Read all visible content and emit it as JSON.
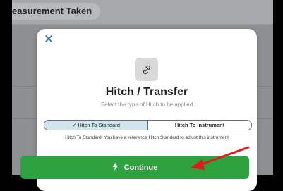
{
  "background": {
    "header_title": "easurement Taken"
  },
  "modal": {
    "close_icon": "close-icon",
    "feature_icon": "link-icon",
    "title": "Hitch / Transfer",
    "subtitle": "Select the type of Hitch to be applied",
    "segments": [
      {
        "label": "✓ Hitch To Standard",
        "selected": true
      },
      {
        "label": "Hitch To Instrument",
        "selected": false
      }
    ],
    "hint": "Hitch To Standard: You have a reference Hitch Standard to adjust this instrument",
    "continue_label": "Continue",
    "continue_icon": "bolt-icon"
  },
  "colors": {
    "continue_bg": "#2ea23f",
    "selected_segment": "#cfe6ee",
    "close_blue": "#2b6cb0",
    "annotation_arrow": "#e11a1a"
  }
}
